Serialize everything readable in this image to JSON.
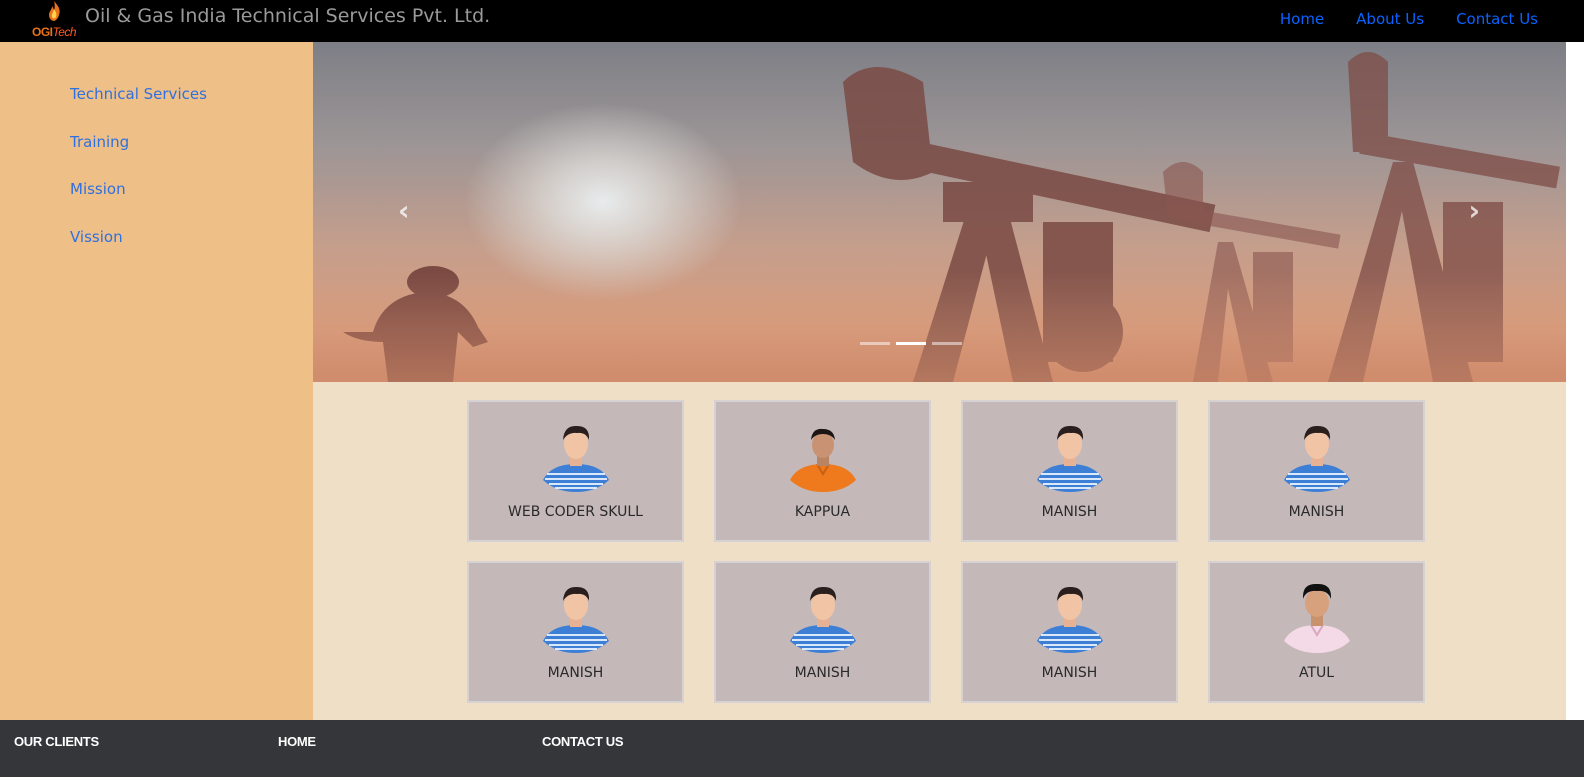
{
  "header": {
    "logo_text_a": "OGI",
    "logo_text_b": "Tech",
    "title": "Oil & Gas India Technical Services Pvt. Ltd.",
    "nav": [
      {
        "label": "Home"
      },
      {
        "label": "About Us"
      },
      {
        "label": "Contact Us"
      }
    ]
  },
  "sidebar": {
    "items": [
      {
        "label": "Technical Services"
      },
      {
        "label": "Training"
      },
      {
        "label": "Mission"
      },
      {
        "label": "Vission"
      }
    ]
  },
  "carousel": {
    "prev_glyph": "‹",
    "next_glyph": "›",
    "slide_count": 3,
    "active_index": 1
  },
  "team": [
    {
      "name": "WEB CODER SKULL",
      "avatar": "striped-shirt-man"
    },
    {
      "name": "KAPPUA",
      "avatar": "orange-shirt-man"
    },
    {
      "name": "MANISH",
      "avatar": "striped-shirt-man"
    },
    {
      "name": "MANISH",
      "avatar": "striped-shirt-man"
    },
    {
      "name": "MANISH",
      "avatar": "striped-shirt-man"
    },
    {
      "name": "MANISH",
      "avatar": "striped-shirt-man"
    },
    {
      "name": "MANISH",
      "avatar": "striped-shirt-man"
    },
    {
      "name": "ATUL",
      "avatar": "pink-shirt-man"
    }
  ],
  "footer": {
    "links": [
      {
        "label": "OUR CLIENTS"
      },
      {
        "label": "HOME"
      },
      {
        "label": "CONTACT US"
      }
    ]
  },
  "colors": {
    "topbar": "#000000",
    "nav_link": "#0a62ff",
    "sidebar_bg": "#eebf87",
    "sidebar_link": "#2f70e0",
    "content_bg": "#efdfc6",
    "card_bg": "#c4b8b8",
    "footer_bg": "#353639"
  }
}
